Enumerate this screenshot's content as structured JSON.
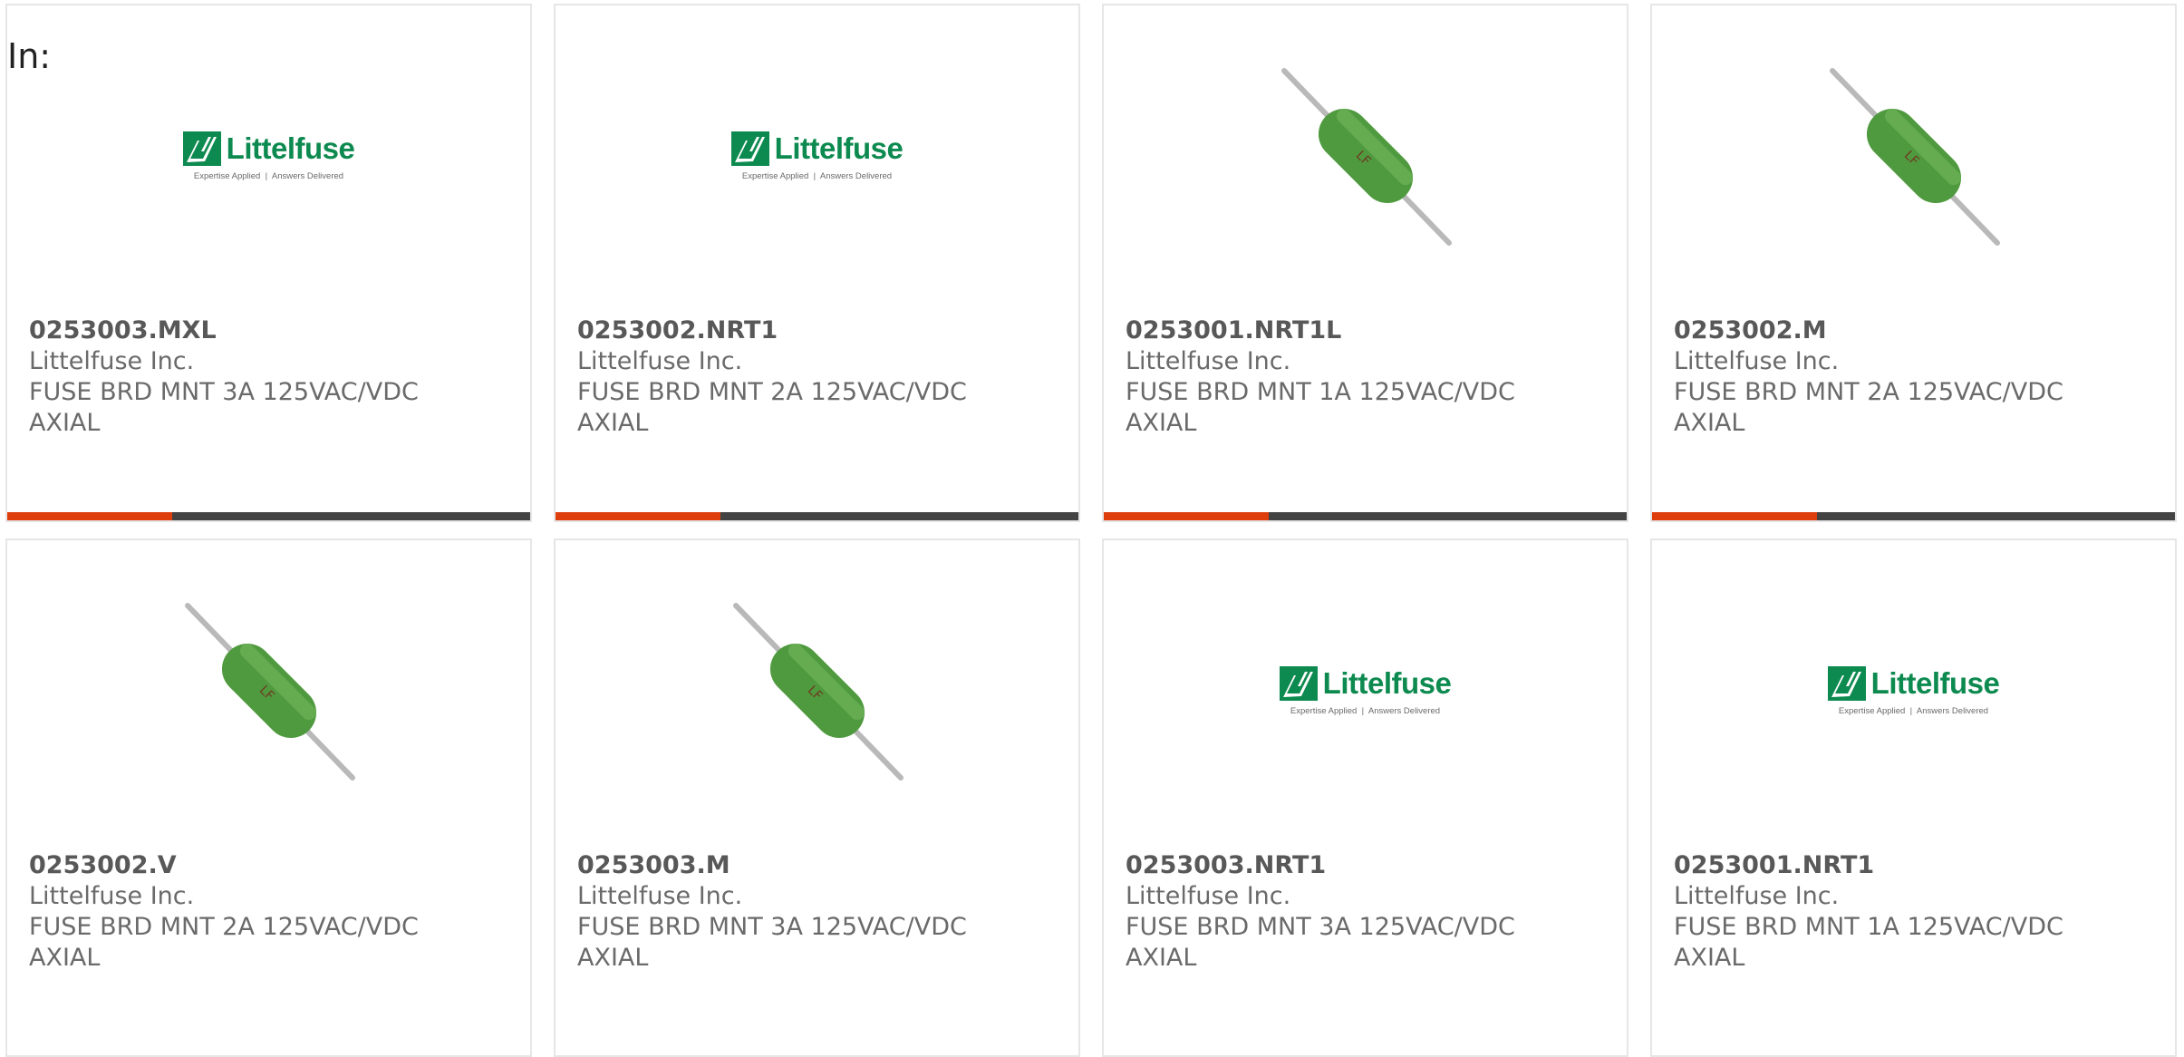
{
  "page": {
    "heading": "In:"
  },
  "brand": {
    "wordmark": "Littelfuse",
    "tagline_left": "Expertise Applied",
    "tagline_right": "Answers Delivered",
    "logo_color": "#0d8a4f"
  },
  "colors": {
    "accent": "#de3e0b",
    "bar_dark": "#434343",
    "card_border": "#e6e6e6",
    "fuse_green": "#4f9a3f"
  },
  "products": [
    {
      "part_number": "0253003.MXL",
      "manufacturer": "Littelfuse Inc.",
      "description_line1": "FUSE BRD MNT 3A 125VAC/VDC",
      "description_line2": "AXIAL",
      "image": "littelfuse-logo",
      "has_accent_bar": true
    },
    {
      "part_number": "0253002.NRT1",
      "manufacturer": "Littelfuse Inc.",
      "description_line1": "FUSE BRD MNT 2A 125VAC/VDC",
      "description_line2": "AXIAL",
      "image": "littelfuse-logo",
      "has_accent_bar": true
    },
    {
      "part_number": "0253001.NRT1L",
      "manufacturer": "Littelfuse Inc.",
      "description_line1": "FUSE BRD MNT 1A 125VAC/VDC",
      "description_line2": "AXIAL",
      "image": "axial-fuse-photo",
      "has_accent_bar": true
    },
    {
      "part_number": "0253002.M",
      "manufacturer": "Littelfuse Inc.",
      "description_line1": "FUSE BRD MNT 2A 125VAC/VDC",
      "description_line2": "AXIAL",
      "image": "axial-fuse-photo",
      "has_accent_bar": true
    },
    {
      "part_number": "0253002.V",
      "manufacturer": "Littelfuse Inc.",
      "description_line1": "FUSE BRD MNT 2A 125VAC/VDC",
      "description_line2": "AXIAL",
      "image": "axial-fuse-photo",
      "has_accent_bar": false
    },
    {
      "part_number": "0253003.M",
      "manufacturer": "Littelfuse Inc.",
      "description_line1": "FUSE BRD MNT 3A 125VAC/VDC",
      "description_line2": "AXIAL",
      "image": "axial-fuse-photo",
      "has_accent_bar": false
    },
    {
      "part_number": "0253003.NRT1",
      "manufacturer": "Littelfuse Inc.",
      "description_line1": "FUSE BRD MNT 3A 125VAC/VDC",
      "description_line2": "AXIAL",
      "image": "littelfuse-logo",
      "has_accent_bar": false
    },
    {
      "part_number": "0253001.NRT1",
      "manufacturer": "Littelfuse Inc.",
      "description_line1": "FUSE BRD MNT 1A 125VAC/VDC",
      "description_line2": "AXIAL",
      "image": "littelfuse-logo",
      "has_accent_bar": false
    }
  ]
}
